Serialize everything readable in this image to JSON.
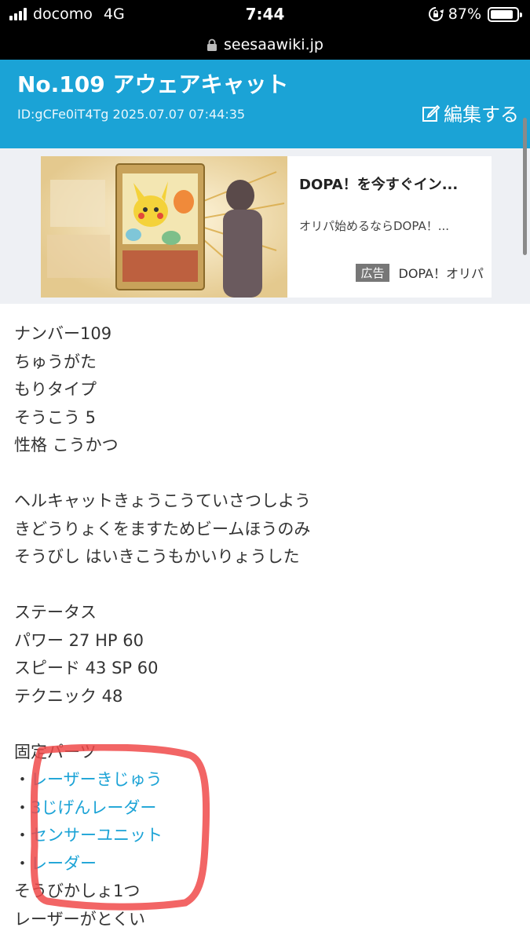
{
  "status_bar": {
    "carrier": "docomo",
    "network": "4G",
    "time": "7:44",
    "battery": "87%",
    "battery_level": 0.87
  },
  "browser": {
    "url": "seesaawiki.jp"
  },
  "header": {
    "title": "No.109 アウェアキャット",
    "meta": "ID:gCFe0iT4Tg 2025.07.07 07:44:35",
    "edit_label": "編集する"
  },
  "ad": {
    "title": "DOPA！を今すぐイン...",
    "description": "オリパ始めるならDOPA！...",
    "badge": "広告",
    "sponsor": "DOPA！オリパ"
  },
  "content": {
    "lines": [
      "ナンバー109",
      "ちゅうがた",
      "もりタイプ",
      "そうこう 5",
      "性格 こうかつ"
    ],
    "description": [
      "ヘルキャットきょうこうていさつしよう",
      "きどうりょくをますためビームほうのみ",
      "そうびし はいきこうもかいりょうした"
    ],
    "status_heading": "ステータス",
    "stats": [
      "パワー 27 HP 60",
      "スピード 43 SP 60",
      "テクニック 48"
    ],
    "parts_heading": "固定パーツ",
    "bullet": "・",
    "parts": [
      "レーザーきじゅう",
      "3じげんレーダー",
      "センサーユニット",
      "レーダー"
    ],
    "footer_lines": [
      "そうびかしょ1つ",
      "レーザーがとくい"
    ]
  },
  "colors": {
    "accent": "#1ba3d6",
    "highlight": "#f04a4a"
  }
}
